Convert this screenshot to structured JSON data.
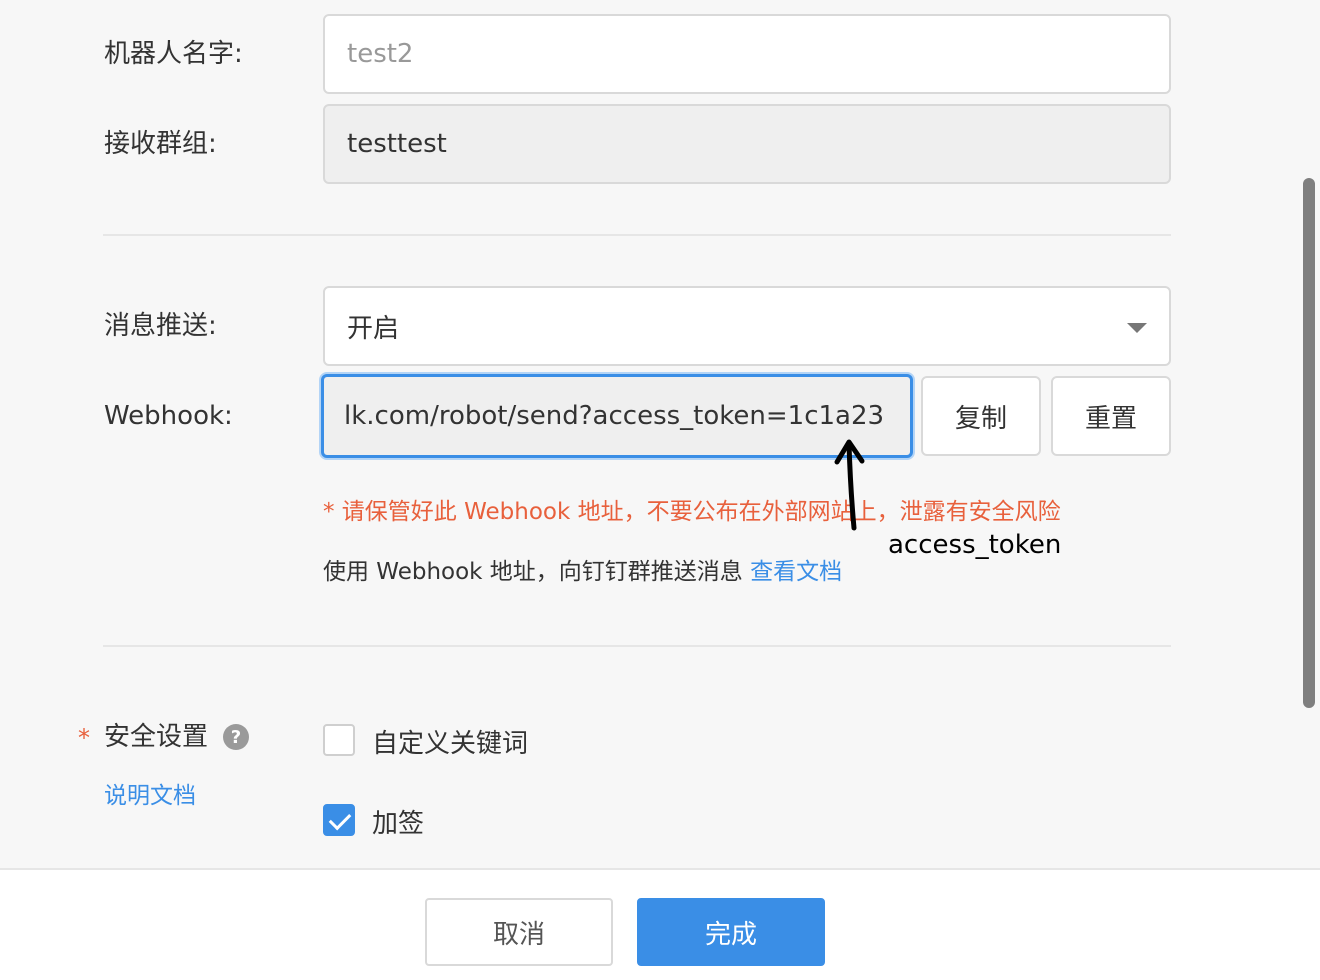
{
  "form": {
    "robot_name": {
      "label": "机器人名字:",
      "value": "test2"
    },
    "receive_group": {
      "label": "接收群组:",
      "value": "testtest"
    },
    "message_push": {
      "label": "消息推送:",
      "selected": "开启"
    },
    "webhook": {
      "label": "Webhook:",
      "value": "lk.com/robot/send?access_token=1c1a23",
      "copy_label": "复制",
      "reset_label": "重置",
      "warning": "* 请保管好此 Webhook 地址，不要公布在外部网站上，泄露有安全风险",
      "info": "使用 Webhook 地址，向钉钉群推送消息",
      "info_link": "查看文档"
    },
    "annotation": {
      "text": "access_token"
    },
    "security": {
      "required_mark": "*",
      "label": "安全设置",
      "help_icon": "question-circle-icon",
      "help_glyph": "?",
      "doc_link": "说明文档",
      "options": [
        {
          "label": "自定义关键词",
          "checked": false
        },
        {
          "label": "加签",
          "checked": true
        }
      ]
    }
  },
  "footer": {
    "cancel_label": "取消",
    "done_label": "完成"
  },
  "colors": {
    "accent": "#3a8ee6",
    "warning": "#e8603c",
    "background": "#f7f7f7"
  }
}
